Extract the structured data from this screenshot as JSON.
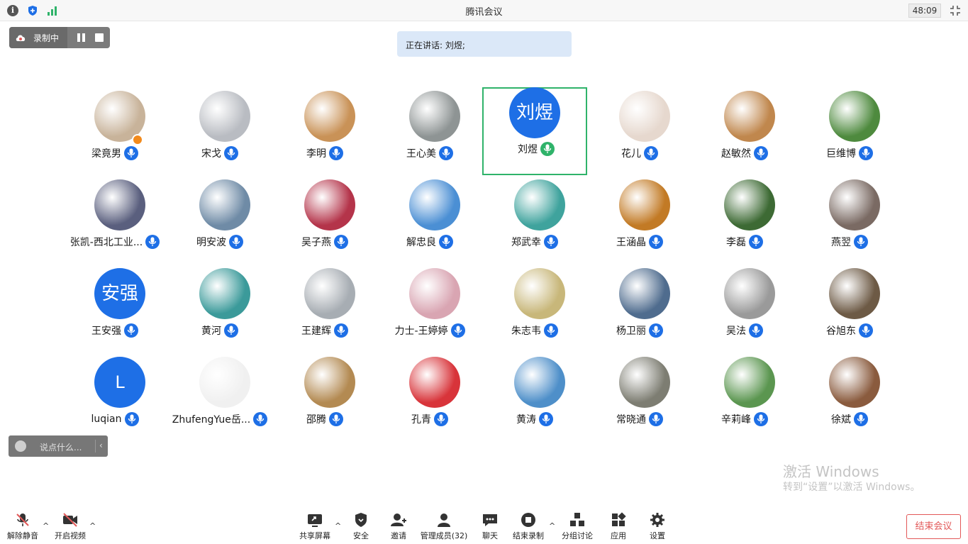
{
  "window": {
    "title": "腾讯会议",
    "timer": "48:09"
  },
  "recording": {
    "label": "录制中"
  },
  "speaking": {
    "text": "正在讲话: 刘煜;"
  },
  "participants": [
    {
      "name": "梁竟男",
      "avatar": "photo",
      "color": "#c8b39a"
    },
    {
      "name": "宋戈",
      "avatar": "photo",
      "color": "#b9bcc2"
    },
    {
      "name": "李明",
      "avatar": "photo",
      "color": "#c99257"
    },
    {
      "name": "王心美",
      "avatar": "photo",
      "color": "#8e9494"
    },
    {
      "name": "刘煜",
      "avatar": "text",
      "avatar_text": "刘煜",
      "color": "#1e6fe6"
    },
    {
      "name": "花儿",
      "avatar": "photo",
      "color": "#e6d8ce"
    },
    {
      "name": "赵敏然",
      "avatar": "photo",
      "color": "#c0874d"
    },
    {
      "name": "巨维博",
      "avatar": "photo",
      "color": "#4e8a3e"
    },
    {
      "name": "张凯-西北工业...",
      "avatar": "photo",
      "color": "#5a5f7e"
    },
    {
      "name": "明安波",
      "avatar": "photo",
      "color": "#6f8ba6"
    },
    {
      "name": "吴子燕",
      "avatar": "photo",
      "color": "#b4344a"
    },
    {
      "name": "解忠良",
      "avatar": "photo",
      "color": "#4b8fd4"
    },
    {
      "name": "郑武幸",
      "avatar": "photo",
      "color": "#3fa39d"
    },
    {
      "name": "王涵晶",
      "avatar": "photo",
      "color": "#c27a25"
    },
    {
      "name": "李磊",
      "avatar": "photo",
      "color": "#3d6a34"
    },
    {
      "name": "燕翌",
      "avatar": "photo",
      "color": "#7a6a63"
    },
    {
      "name": "王安强",
      "avatar": "text",
      "avatar_text": "安强",
      "color": "#1e6fe6"
    },
    {
      "name": "黄河",
      "avatar": "photo",
      "color": "#3b9a9a"
    },
    {
      "name": "王建辉",
      "avatar": "photo",
      "color": "#a7adb3"
    },
    {
      "name": "力士-王婷婷",
      "avatar": "photo",
      "color": "#d9a5b2"
    },
    {
      "name": "朱志韦",
      "avatar": "photo",
      "color": "#c8b77a"
    },
    {
      "name": "杨卫丽",
      "avatar": "photo",
      "color": "#4f6c8e"
    },
    {
      "name": "吴法",
      "avatar": "photo",
      "color": "#9a9a9a"
    },
    {
      "name": "谷旭东",
      "avatar": "photo",
      "color": "#6d5a45"
    },
    {
      "name": "luqian",
      "avatar": "text",
      "avatar_text": "L",
      "color": "#1e6fe6"
    },
    {
      "name": "ZhufengYue岳...",
      "avatar": "photo",
      "color": "#f0f0f0"
    },
    {
      "name": "邵腾",
      "avatar": "photo",
      "color": "#b38a52"
    },
    {
      "name": "孔青",
      "avatar": "photo",
      "color": "#d8343a"
    },
    {
      "name": "黄涛",
      "avatar": "photo",
      "color": "#4e8fc9"
    },
    {
      "name": "常晓通",
      "avatar": "photo",
      "color": "#7d7d72"
    },
    {
      "name": "辛莉峰",
      "avatar": "photo",
      "color": "#5b9650"
    },
    {
      "name": "徐斌",
      "avatar": "photo",
      "color": "#8a5b3e"
    }
  ],
  "chat": {
    "placeholder": "说点什么..."
  },
  "watermark": {
    "line1": "激活 Windows",
    "line2": "转到“设置”以激活 Windows。"
  },
  "toolbar": {
    "unmute": "解除静音",
    "start_video": "开启视频",
    "share_screen": "共享屏幕",
    "security": "安全",
    "invite": "邀请",
    "manage_members": "管理成员(32)",
    "chat": "聊天",
    "end_recording": "结束录制",
    "breakout": "分组讨论",
    "apps": "应用",
    "settings": "设置",
    "end_meeting": "结束会议"
  }
}
